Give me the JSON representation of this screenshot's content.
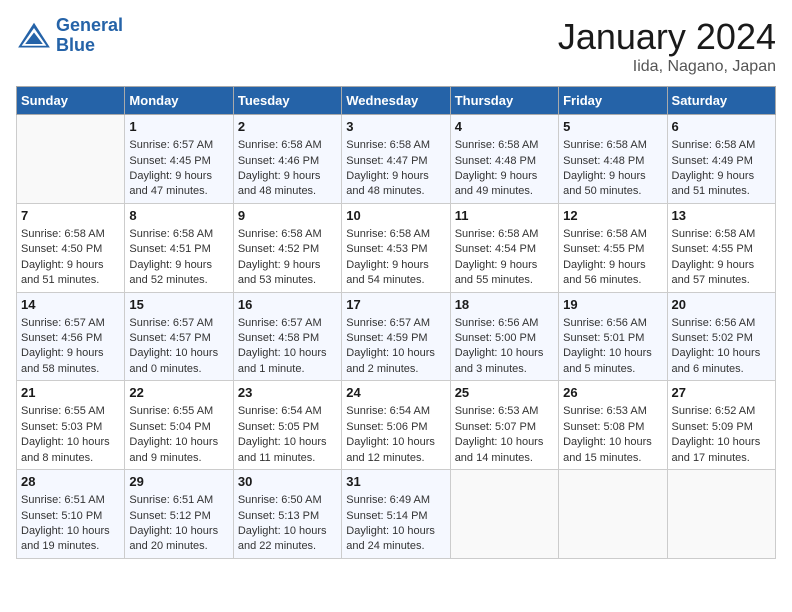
{
  "header": {
    "logo_line1": "General",
    "logo_line2": "Blue",
    "title": "January 2024",
    "subtitle": "Iida, Nagano, Japan"
  },
  "days_of_week": [
    "Sunday",
    "Monday",
    "Tuesday",
    "Wednesday",
    "Thursday",
    "Friday",
    "Saturday"
  ],
  "weeks": [
    [
      {
        "day": "",
        "data": ""
      },
      {
        "day": "1",
        "data": "Sunrise: 6:57 AM\nSunset: 4:45 PM\nDaylight: 9 hours\nand 47 minutes."
      },
      {
        "day": "2",
        "data": "Sunrise: 6:58 AM\nSunset: 4:46 PM\nDaylight: 9 hours\nand 48 minutes."
      },
      {
        "day": "3",
        "data": "Sunrise: 6:58 AM\nSunset: 4:47 PM\nDaylight: 9 hours\nand 48 minutes."
      },
      {
        "day": "4",
        "data": "Sunrise: 6:58 AM\nSunset: 4:48 PM\nDaylight: 9 hours\nand 49 minutes."
      },
      {
        "day": "5",
        "data": "Sunrise: 6:58 AM\nSunset: 4:48 PM\nDaylight: 9 hours\nand 50 minutes."
      },
      {
        "day": "6",
        "data": "Sunrise: 6:58 AM\nSunset: 4:49 PM\nDaylight: 9 hours\nand 51 minutes."
      }
    ],
    [
      {
        "day": "7",
        "data": "Sunrise: 6:58 AM\nSunset: 4:50 PM\nDaylight: 9 hours\nand 51 minutes."
      },
      {
        "day": "8",
        "data": "Sunrise: 6:58 AM\nSunset: 4:51 PM\nDaylight: 9 hours\nand 52 minutes."
      },
      {
        "day": "9",
        "data": "Sunrise: 6:58 AM\nSunset: 4:52 PM\nDaylight: 9 hours\nand 53 minutes."
      },
      {
        "day": "10",
        "data": "Sunrise: 6:58 AM\nSunset: 4:53 PM\nDaylight: 9 hours\nand 54 minutes."
      },
      {
        "day": "11",
        "data": "Sunrise: 6:58 AM\nSunset: 4:54 PM\nDaylight: 9 hours\nand 55 minutes."
      },
      {
        "day": "12",
        "data": "Sunrise: 6:58 AM\nSunset: 4:55 PM\nDaylight: 9 hours\nand 56 minutes."
      },
      {
        "day": "13",
        "data": "Sunrise: 6:58 AM\nSunset: 4:55 PM\nDaylight: 9 hours\nand 57 minutes."
      }
    ],
    [
      {
        "day": "14",
        "data": "Sunrise: 6:57 AM\nSunset: 4:56 PM\nDaylight: 9 hours\nand 58 minutes."
      },
      {
        "day": "15",
        "data": "Sunrise: 6:57 AM\nSunset: 4:57 PM\nDaylight: 10 hours\nand 0 minutes."
      },
      {
        "day": "16",
        "data": "Sunrise: 6:57 AM\nSunset: 4:58 PM\nDaylight: 10 hours\nand 1 minute."
      },
      {
        "day": "17",
        "data": "Sunrise: 6:57 AM\nSunset: 4:59 PM\nDaylight: 10 hours\nand 2 minutes."
      },
      {
        "day": "18",
        "data": "Sunrise: 6:56 AM\nSunset: 5:00 PM\nDaylight: 10 hours\nand 3 minutes."
      },
      {
        "day": "19",
        "data": "Sunrise: 6:56 AM\nSunset: 5:01 PM\nDaylight: 10 hours\nand 5 minutes."
      },
      {
        "day": "20",
        "data": "Sunrise: 6:56 AM\nSunset: 5:02 PM\nDaylight: 10 hours\nand 6 minutes."
      }
    ],
    [
      {
        "day": "21",
        "data": "Sunrise: 6:55 AM\nSunset: 5:03 PM\nDaylight: 10 hours\nand 8 minutes."
      },
      {
        "day": "22",
        "data": "Sunrise: 6:55 AM\nSunset: 5:04 PM\nDaylight: 10 hours\nand 9 minutes."
      },
      {
        "day": "23",
        "data": "Sunrise: 6:54 AM\nSunset: 5:05 PM\nDaylight: 10 hours\nand 11 minutes."
      },
      {
        "day": "24",
        "data": "Sunrise: 6:54 AM\nSunset: 5:06 PM\nDaylight: 10 hours\nand 12 minutes."
      },
      {
        "day": "25",
        "data": "Sunrise: 6:53 AM\nSunset: 5:07 PM\nDaylight: 10 hours\nand 14 minutes."
      },
      {
        "day": "26",
        "data": "Sunrise: 6:53 AM\nSunset: 5:08 PM\nDaylight: 10 hours\nand 15 minutes."
      },
      {
        "day": "27",
        "data": "Sunrise: 6:52 AM\nSunset: 5:09 PM\nDaylight: 10 hours\nand 17 minutes."
      }
    ],
    [
      {
        "day": "28",
        "data": "Sunrise: 6:51 AM\nSunset: 5:10 PM\nDaylight: 10 hours\nand 19 minutes."
      },
      {
        "day": "29",
        "data": "Sunrise: 6:51 AM\nSunset: 5:12 PM\nDaylight: 10 hours\nand 20 minutes."
      },
      {
        "day": "30",
        "data": "Sunrise: 6:50 AM\nSunset: 5:13 PM\nDaylight: 10 hours\nand 22 minutes."
      },
      {
        "day": "31",
        "data": "Sunrise: 6:49 AM\nSunset: 5:14 PM\nDaylight: 10 hours\nand 24 minutes."
      },
      {
        "day": "",
        "data": ""
      },
      {
        "day": "",
        "data": ""
      },
      {
        "day": "",
        "data": ""
      }
    ]
  ]
}
